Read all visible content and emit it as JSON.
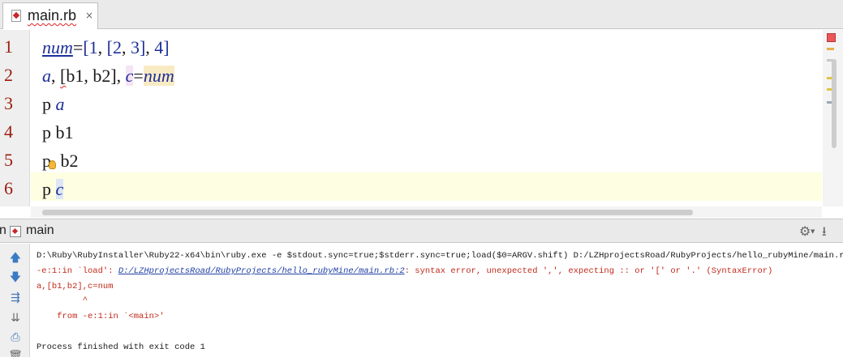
{
  "tab": {
    "label": "main.rb",
    "close_glyph": "×",
    "icon": "ruby-file-icon"
  },
  "editor": {
    "line_numbers": [
      "1",
      "2",
      "3",
      "4",
      "5",
      "6"
    ],
    "lines": [
      {
        "tokens": [
          {
            "t": "num",
            "c": "decl"
          },
          {
            "t": "=",
            "c": ""
          },
          {
            "t": "[",
            "c": "num"
          },
          {
            "t": "1",
            "c": "num"
          },
          {
            "t": ", ",
            "c": ""
          },
          {
            "t": "[",
            "c": "num"
          },
          {
            "t": "2",
            "c": "num"
          },
          {
            "t": ", ",
            "c": ""
          },
          {
            "t": "3",
            "c": "num"
          },
          {
            "t": "]",
            "c": "num"
          },
          {
            "t": ", ",
            "c": ""
          },
          {
            "t": "4",
            "c": "num"
          },
          {
            "t": "]",
            "c": "num"
          }
        ]
      },
      {
        "tokens": [
          {
            "t": "a",
            "c": "local"
          },
          {
            "t": ", ",
            "c": ""
          },
          {
            "t": "[",
            "c": "err"
          },
          {
            "t": "b1",
            "c": ""
          },
          {
            "t": ", ",
            "c": ""
          },
          {
            "t": "b2",
            "c": ""
          },
          {
            "t": "], ",
            "c": ""
          },
          {
            "t": "c",
            "c": "local hl-pink"
          },
          {
            "t": "=",
            "c": ""
          },
          {
            "t": "num",
            "c": "local hl-yellow"
          }
        ]
      },
      {
        "tokens": [
          {
            "t": "p ",
            "c": ""
          },
          {
            "t": "a",
            "c": "local"
          }
        ]
      },
      {
        "tokens": [
          {
            "t": "p ",
            "c": ""
          },
          {
            "t": "b1",
            "c": ""
          }
        ]
      },
      {
        "tokens": [
          {
            "t": "p",
            "c": ""
          },
          {
            "t": "BULB",
            "c": "bulb"
          },
          {
            "t": " b2",
            "c": ""
          }
        ]
      },
      {
        "tokens": [
          {
            "t": "p ",
            "c": ""
          },
          {
            "t": "c",
            "c": "local hl-blue"
          }
        ]
      }
    ]
  },
  "run_panel": {
    "prefix": "n",
    "title": "main",
    "gear_glyph": "⚙",
    "gear_arrow": "▼",
    "hide_glyph": "⭳",
    "tools": [
      {
        "name": "up-arrow-icon",
        "glyph": "🡅",
        "color": "#3a7cc4"
      },
      {
        "name": "down-arrow-icon",
        "glyph": "🡇",
        "color": "#3a7cc4"
      },
      {
        "name": "soft-wrap-icon",
        "glyph": "⇶",
        "color": "#4a79b8"
      },
      {
        "name": "scroll-to-end-icon",
        "glyph": "⇊",
        "color": "#6a6a6a"
      },
      {
        "name": "print-icon",
        "glyph": "⎙",
        "color": "#4a79b8"
      },
      {
        "name": "clear-icon",
        "glyph": "🗑",
        "color": "#6a6a6a"
      }
    ],
    "console": {
      "command": "D:\\Ruby\\RubyInstaller\\Ruby22-x64\\bin\\ruby.exe -e $stdout.sync=true;$stderr.sync=true;load($0=ARGV.shift) D:/LZHprojectsRoad/RubyProjects/hello_rubyMine/main.rb",
      "error_prefix": "-e:1:in `load': ",
      "error_link": "D:/LZHprojectsRoad/RubyProjects/hello_rubyMine/main.rb:2",
      "error_suffix": ": syntax error, unexpected ',', expecting :: or '[' or '.' (SyntaxError)",
      "source_line": "a,[b1,b2],c=num",
      "caret_line": "         ^",
      "from_line": "    from -e:1:in `<main>'",
      "exit_line": "Process finished with exit code 1"
    }
  }
}
